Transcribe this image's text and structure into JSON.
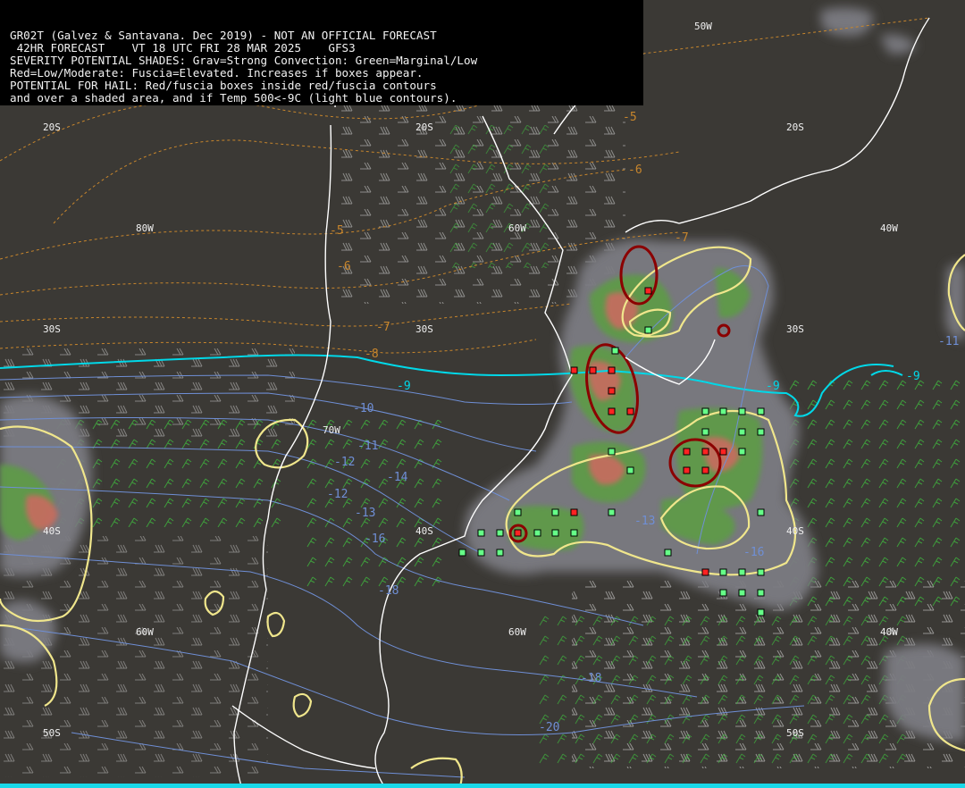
{
  "header": {
    "lines": [
      "GR02T (Galvez & Santavana. Dec 2019) - NOT AN OFFICIAL FORECAST",
      " 42HR FORECAST    VT 18 UTC FRI 28 MAR 2025    GFS3",
      "SEVERITY POTENTIAL SHADES: Grav=Strong Convection: Green=Marginal/Low",
      "Red=Low/Moderate: Fuscia=Elevated. Increases if boxes appear.",
      "POTENTIAL FOR HAIL: Red/fuscia boxes inside red/fuscia contours",
      "and over a shaded area, and if Temp 500<-9C (light blue contours)."
    ]
  },
  "coordinate_labels": [
    {
      "id": "lon-50w-top",
      "text": "50W"
    },
    {
      "id": "lat-20s-left",
      "text": "20S"
    },
    {
      "id": "lat-20s-mid",
      "text": "20S"
    },
    {
      "id": "lat-20s-right",
      "text": "20S"
    },
    {
      "id": "lon-80w",
      "text": "80W"
    },
    {
      "id": "lon-60w-top",
      "text": "60W"
    },
    {
      "id": "lon-40w-top",
      "text": "40W"
    },
    {
      "id": "lat-30s-left",
      "text": "30S"
    },
    {
      "id": "lat-30s-mid",
      "text": "30S"
    },
    {
      "id": "lat-30s-right",
      "text": "30S"
    },
    {
      "id": "lon-70w",
      "text": "70W"
    },
    {
      "id": "lat-40s-left",
      "text": "40S"
    },
    {
      "id": "lat-40s-mid",
      "text": "40S"
    },
    {
      "id": "lat-40s-right",
      "text": "40S"
    },
    {
      "id": "lon-60w-lower-left",
      "text": "60W"
    },
    {
      "id": "lon-60w-lower",
      "text": "60W"
    },
    {
      "id": "lon-40w-lower",
      "text": "40W"
    },
    {
      "id": "lat-50s-left",
      "text": "50S"
    },
    {
      "id": "lat-50s-right",
      "text": "50S"
    }
  ],
  "temperature_labels": [
    {
      "id": "t-5a",
      "text": "-5",
      "kind": "dashed"
    },
    {
      "id": "t-6a",
      "text": "-6",
      "kind": "dashed"
    },
    {
      "id": "t-5b",
      "text": "-5",
      "kind": "dashed"
    },
    {
      "id": "t-6b",
      "text": "-6",
      "kind": "dashed"
    },
    {
      "id": "t-7a",
      "text": "-7",
      "kind": "dashed"
    },
    {
      "id": "t-7b",
      "text": "-7",
      "kind": "dashed"
    },
    {
      "id": "t-8",
      "text": "-8",
      "kind": "dashed"
    },
    {
      "id": "t-9a",
      "text": "-9",
      "kind": "cyan"
    },
    {
      "id": "t-9b",
      "text": "-9",
      "kind": "cyan"
    },
    {
      "id": "t-9c",
      "text": "-9",
      "kind": "cyan"
    },
    {
      "id": "t-10",
      "text": "-10",
      "kind": "blue"
    },
    {
      "id": "t-11a",
      "text": "-11",
      "kind": "blue"
    },
    {
      "id": "t-11b",
      "text": "-11",
      "kind": "blue"
    },
    {
      "id": "t-12a",
      "text": "-12",
      "kind": "blue"
    },
    {
      "id": "t-12b",
      "text": "-12",
      "kind": "blue"
    },
    {
      "id": "t-13a",
      "text": "-13",
      "kind": "blue"
    },
    {
      "id": "t-13b",
      "text": "-13",
      "kind": "blue"
    },
    {
      "id": "t-14",
      "text": "-14",
      "kind": "blue"
    },
    {
      "id": "t-16a",
      "text": "-16",
      "kind": "blue"
    },
    {
      "id": "t-16b",
      "text": "-16",
      "kind": "blue"
    },
    {
      "id": "t-18a",
      "text": "-18",
      "kind": "blue"
    },
    {
      "id": "t-18b",
      "text": "-18",
      "kind": "blue"
    },
    {
      "id": "t-20",
      "text": "-20",
      "kind": "blue"
    }
  ],
  "colors": {
    "background": "#3b3935",
    "coastline": "#ffffff",
    "shade_strong": "#7c7c82",
    "shade_marginal": "#5e9a48",
    "shade_moderate": "#c46d5e",
    "hail_contour": "#8b0000",
    "instability_contour": "#f0e68c",
    "isotherm_cold": "#00d8e8",
    "isotherm_blue": "#6f8fd6",
    "isotherm_warm": "#c8862c",
    "wind_barbs_white": "#d8d8d8",
    "wind_barbs_green": "#44cc44",
    "box_green": "#66ff88",
    "box_red": "#ff2222"
  }
}
